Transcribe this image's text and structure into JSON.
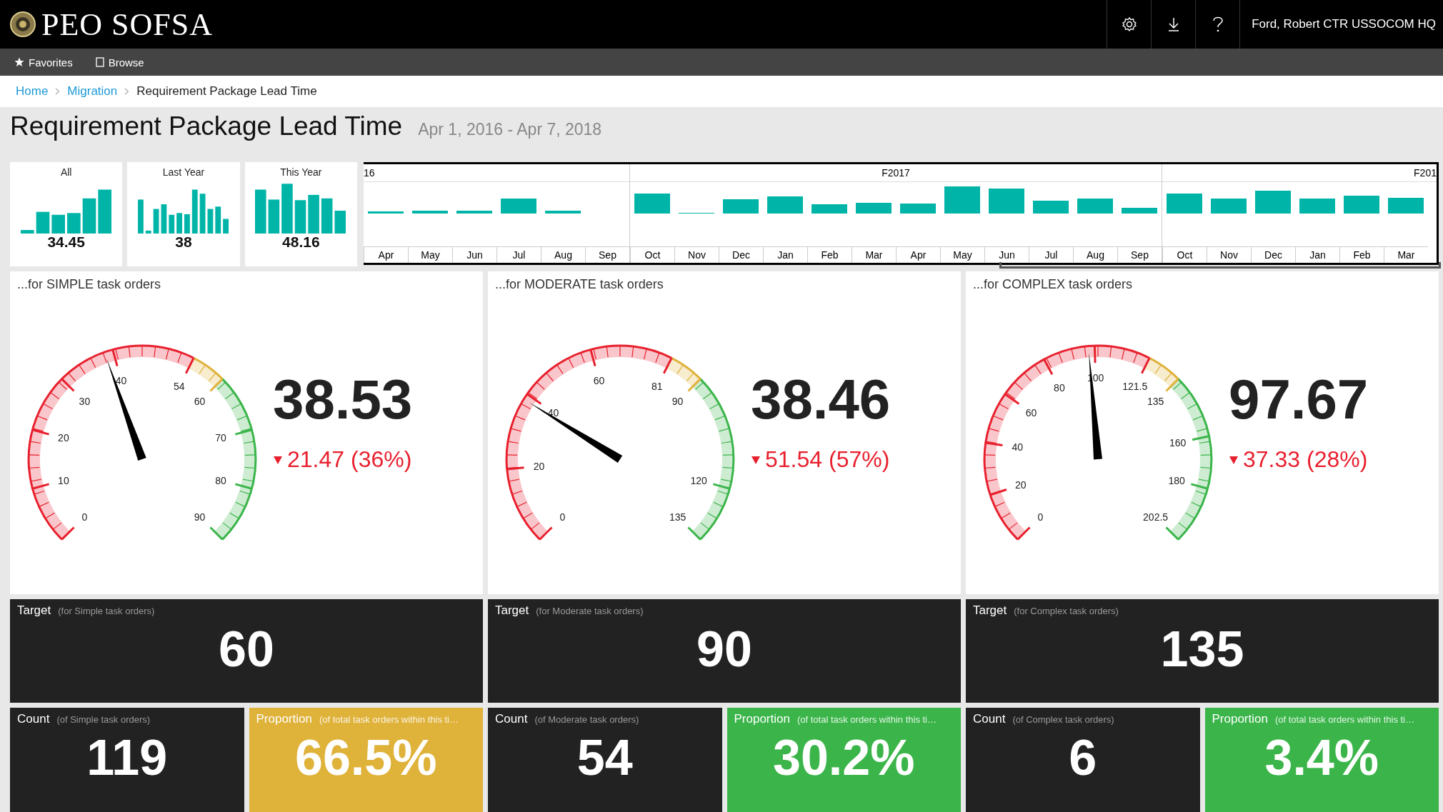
{
  "header": {
    "logo_text": "PEO SOFSA",
    "user": "Ford, Robert CTR USSOCOM HQ"
  },
  "nav": [
    {
      "kind": "star",
      "label": "Favorites"
    },
    {
      "kind": "page",
      "label": "Browse"
    }
  ],
  "breadcrumb": [
    {
      "label": "Home",
      "link": true
    },
    {
      "label": "Migration",
      "link": true
    },
    {
      "label": "Requirement Package Lead Time",
      "link": false
    }
  ],
  "page": {
    "title": "Requirement Package Lead Time",
    "date_range": "Apr 1, 2016 - Apr 7, 2018"
  },
  "summaries": [
    {
      "label": "All",
      "value": "34.45"
    },
    {
      "label": "Last Year",
      "value": "38"
    },
    {
      "label": "This Year",
      "value": "48.16"
    }
  ],
  "timeline": {
    "years": [
      {
        "label": "16",
        "months": [
          "Apr",
          "May",
          "Jun",
          "Jul",
          "Aug",
          "Sep"
        ]
      },
      {
        "label": "F2017",
        "months": [
          "Oct",
          "Nov",
          "Dec",
          "Jan",
          "Feb",
          "Mar",
          "Apr",
          "May",
          "Jun",
          "Jul",
          "Aug",
          "Sep"
        ]
      },
      {
        "label": "F201",
        "months": [
          "Oct",
          "Nov",
          "Dec",
          "Jan",
          "Feb",
          "Mar"
        ]
      }
    ]
  },
  "gauges": [
    {
      "title": "...for SIMPLE task orders",
      "ticks": [
        {
          "label": "0",
          "color": "#e8202e"
        },
        {
          "label": "10"
        },
        {
          "label": "20"
        },
        {
          "label": "30"
        },
        {
          "label": "40"
        },
        {
          "label": "54",
          "color": "#dfb23a"
        },
        {
          "label": "60",
          "color": "#3bb54a"
        },
        {
          "label": "70"
        },
        {
          "label": "80"
        },
        {
          "label": "90"
        }
      ],
      "level": 0.428,
      "value": "38.53",
      "delta": "21.47 (36%)"
    },
    {
      "title": "...for MODERATE task orders",
      "ticks": [
        {
          "label": "0",
          "color": "#e8202e"
        },
        {
          "label": "20"
        },
        {
          "label": "40"
        },
        {
          "label": "60"
        },
        {
          "label": "81",
          "color": "#dfb23a"
        },
        {
          "label": "90",
          "color": "#3bb54a"
        },
        {
          "label": "120"
        },
        {
          "label": "135"
        }
      ],
      "level": 0.285,
      "value": "38.46",
      "delta": "51.54 (57%)"
    },
    {
      "title": "...for COMPLEX task orders",
      "ticks": [
        {
          "label": "0",
          "color": "#e8202e"
        },
        {
          "label": "20"
        },
        {
          "label": "40"
        },
        {
          "label": "60"
        },
        {
          "label": "80"
        },
        {
          "label": "100"
        },
        {
          "label": "121.5",
          "color": "#dfb23a"
        },
        {
          "label": "135",
          "color": "#3bb54a"
        },
        {
          "label": "160"
        },
        {
          "label": "180"
        },
        {
          "label": "202.5"
        }
      ],
      "level": 0.482,
      "value": "97.67",
      "delta": "37.33 (28%)"
    }
  ],
  "targets": [
    {
      "label": "Target",
      "note": "(for Simple task orders)",
      "value": "60"
    },
    {
      "label": "Target",
      "note": "(for Moderate task orders)",
      "value": "90"
    },
    {
      "label": "Target",
      "note": "(for Complex task orders)",
      "value": "135"
    }
  ],
  "stats": [
    {
      "kind": "count",
      "label": "Count",
      "note": "(of Simple task orders)",
      "value": "119"
    },
    {
      "kind": "proportion",
      "label": "Proportion",
      "note": "(of total task orders within this ti…",
      "value": "66.5%",
      "color": "#dfb23a"
    },
    {
      "kind": "count",
      "label": "Count",
      "note": "(of Moderate task orders)",
      "value": "54"
    },
    {
      "kind": "proportion",
      "label": "Proportion",
      "note": "(of total task orders within this ti…",
      "value": "30.2%",
      "color": "#3bb54a"
    },
    {
      "kind": "count",
      "label": "Count",
      "note": "(of Complex task orders)",
      "value": "6"
    },
    {
      "kind": "proportion",
      "label": "Proportion",
      "note": "(of total task orders within this ti…",
      "value": "3.4%",
      "color": "#3bb54a"
    }
  ]
}
